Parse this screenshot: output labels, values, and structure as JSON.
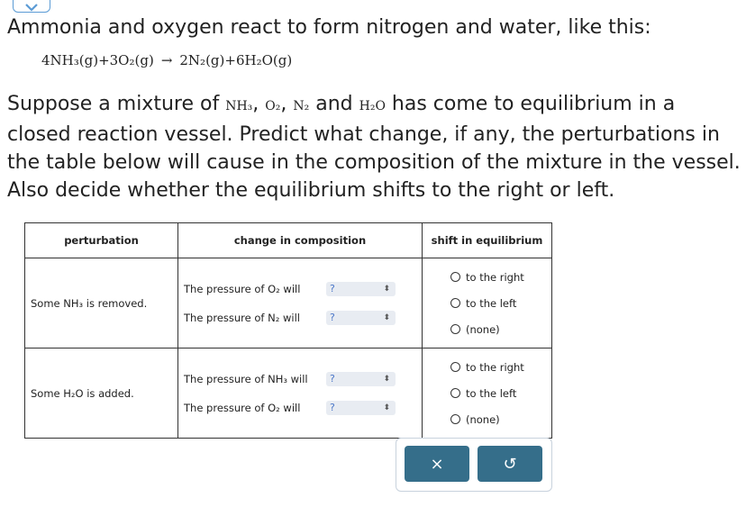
{
  "intro_text": "Ammonia and oxygen react to form nitrogen and water, like this:",
  "equation": {
    "lhs": "4NH₃(g)+3O₂(g)",
    "arrow": "→",
    "rhs": "2N₂(g)+6H₂O(g)"
  },
  "question": {
    "part1": "Suppose a mixture of ",
    "s1": "NH₃",
    "c1": ", ",
    "s2": "O₂",
    "c2": ", ",
    "s3": "N₂",
    "and": " and ",
    "s4": "H₂O",
    "part2": " has come to equilibrium in a closed reaction vessel. Predict what change, if any, the perturbations in the table below will cause in the composition of the mixture in the vessel. Also decide whether the equilibrium shifts to the right or left."
  },
  "table": {
    "headers": [
      "perturbation",
      "change in composition",
      "shift in equilibrium"
    ],
    "rows": [
      {
        "perturbation": "Some NH₃ is removed.",
        "changes": [
          {
            "label": "The pressure of O₂ will",
            "value": "?"
          },
          {
            "label": "The pressure of N₂ will",
            "value": "?"
          }
        ],
        "options": [
          "to the right",
          "to the left",
          "(none)"
        ]
      },
      {
        "perturbation": "Some H₂O is added.",
        "changes": [
          {
            "label": "The pressure of NH₃ will",
            "value": "?"
          },
          {
            "label": "The pressure of O₂ will",
            "value": "?"
          }
        ],
        "options": [
          "to the right",
          "to the left",
          "(none)"
        ]
      }
    ]
  },
  "buttons": {
    "clear_symbol": "×",
    "undo_symbol": "↺"
  }
}
